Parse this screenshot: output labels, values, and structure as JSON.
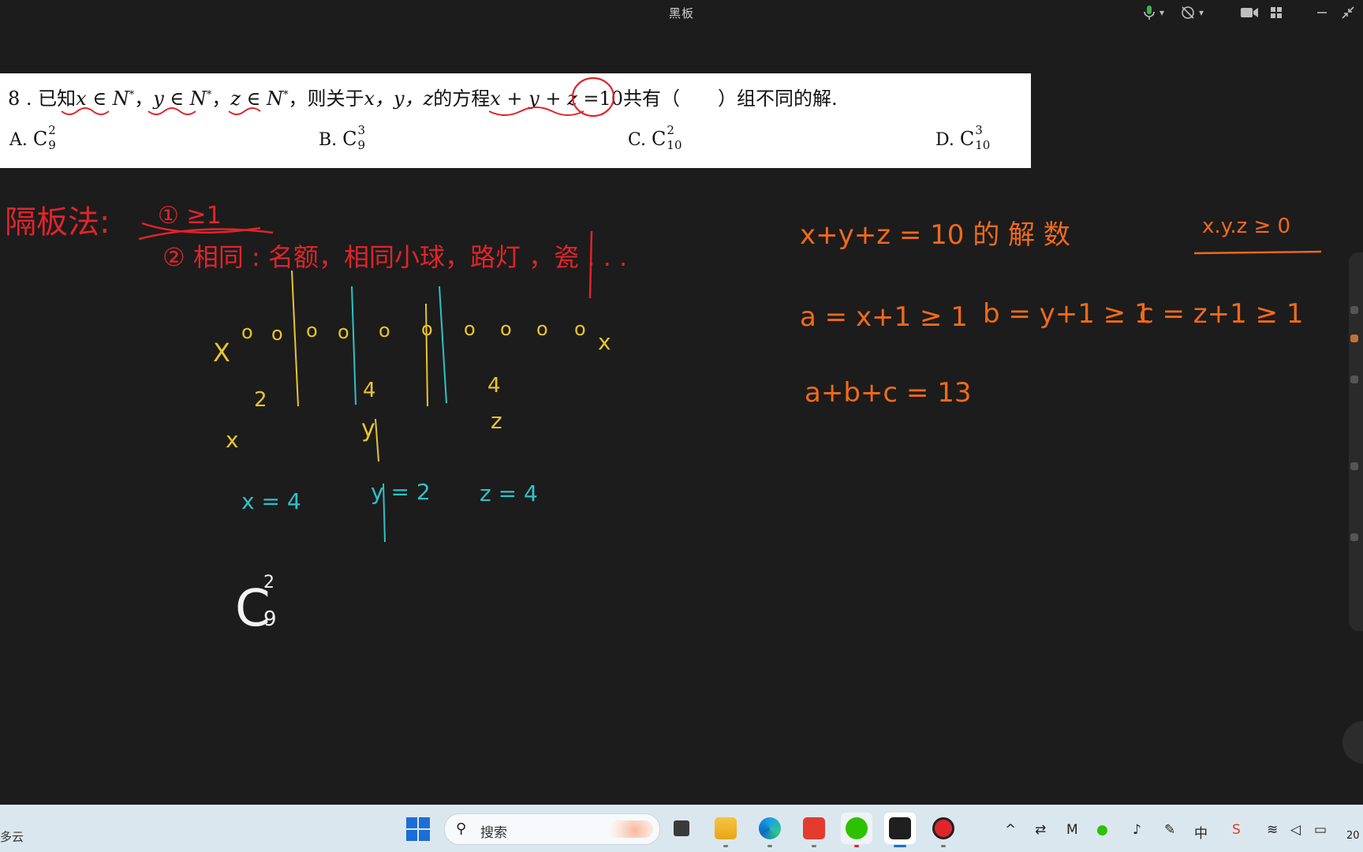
{
  "window": {
    "title": "黑板"
  },
  "titlebar": {
    "icons": [
      "microphone-icon",
      "dropdown-arrow-icon",
      "speaker-muted-icon",
      "dropdown-arrow-icon",
      "camera-icon",
      "grid-view-icon",
      "minimize-icon",
      "shrink-icon"
    ]
  },
  "question": {
    "number": "8",
    "stem": {
      "prefix": "8 . 已知",
      "x_in": "x ∈ N",
      "star": "*",
      "sep": "，",
      "y_in": "y ∈ N",
      "z_in": "z ∈ N",
      "mid": "，则关于",
      "vars": "x，y，z",
      "eq_intro": "的方程",
      "equation": "x + y + z = ",
      "ten": "10",
      "suffix": "共有（　　）组不同的解."
    },
    "options": [
      {
        "label": "A.",
        "c": "C",
        "sup": "2",
        "sub": "9"
      },
      {
        "label": "B.",
        "c": "C",
        "sup": "3",
        "sub": "9"
      },
      {
        "label": "C.",
        "c": "C",
        "sup": "2",
        "sub": "10"
      },
      {
        "label": "D.",
        "c": "C",
        "sup": "3",
        "sub": "10"
      }
    ]
  },
  "board": {
    "colors": {
      "red": "#e0242b",
      "yellow": "#e9c62b",
      "teal": "#2fc2c6",
      "orange": "#f06a1a",
      "white": "#f2f2f2"
    },
    "red_notes": {
      "method": "隔板法:",
      "cond1": "① ≥1",
      "cond2": "② 相同 : 名额，相同小球，路灯 ，瓷 . . ."
    },
    "yellow_notes": {
      "row_label_left": "X",
      "balls": [
        "o",
        "o",
        "o",
        "o",
        "o",
        "o",
        "o",
        "o",
        "o",
        "o"
      ],
      "row_label_right": "x",
      "count_2": "2",
      "count_4a": "4",
      "count_4b": "4",
      "var_x": "x",
      "var_y": "y",
      "var_z": "z"
    },
    "teal_notes": {
      "x_val": "x = 4",
      "y_val": "y = 2",
      "z_val": "z = 4"
    },
    "white_notes": {
      "answer": "C",
      "answer_sup": "2",
      "answer_sub": "9"
    },
    "orange_notes": {
      "line1": "x+y+z = 10 的 解 数",
      "line1_cond": "x.y.z ≥ 0",
      "line2_a": "a = x+1 ≥ 1",
      "line2_b": "b = y+1 ≥ 1",
      "line2_c": "c = z+1 ≥ 1",
      "line3": "a+b+c = 13"
    }
  },
  "taskbar": {
    "weather": "多云",
    "search_placeholder": "搜索",
    "apps": [
      "windows-start-icon",
      "task-view-icon",
      "file-explorer-icon",
      "edge-icon",
      "wps-icon",
      "wechat-icon",
      "whiteboard-app-icon",
      "recorder-icon"
    ],
    "tray": {
      "chevron": "^",
      "ime": "中",
      "clock": "20"
    }
  }
}
